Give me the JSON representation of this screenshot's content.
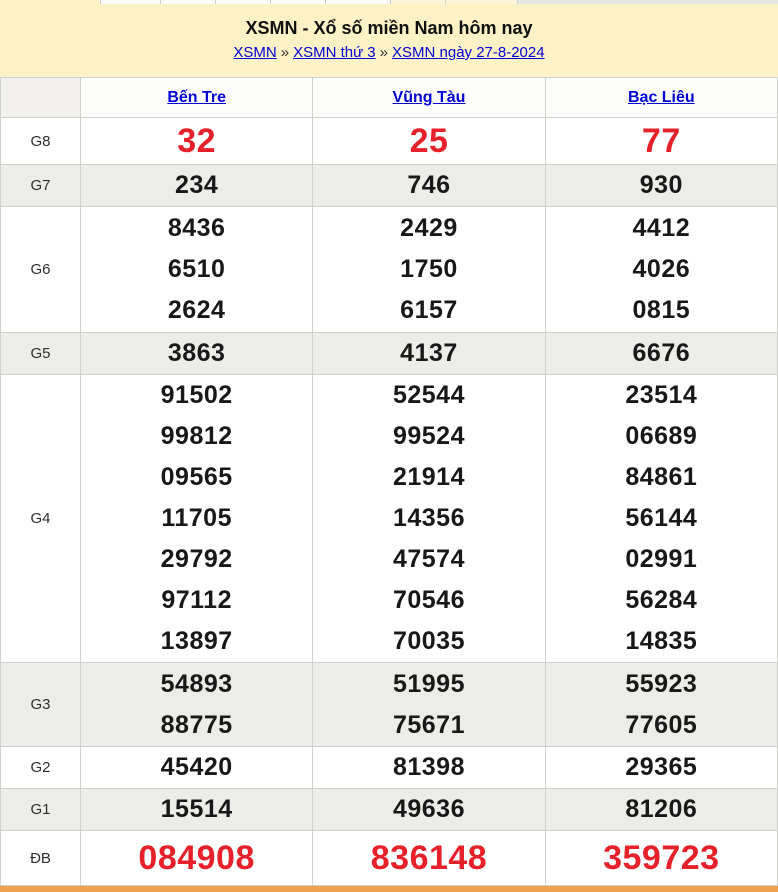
{
  "header": {
    "title": "XSMN - Xổ số miền Nam hôm nay",
    "breadcrumb": {
      "separator": "»",
      "items": [
        {
          "label": "XSMN"
        },
        {
          "label": "XSMN thứ 3"
        },
        {
          "label": "XSMN ngày 27-8-2024"
        }
      ]
    }
  },
  "table": {
    "columns": [
      "Bến Tre",
      "Vũng Tàu",
      "Bạc Liêu"
    ],
    "rows": [
      {
        "prize": "G8",
        "key": "g8",
        "highlight": true,
        "values": [
          [
            "32"
          ],
          [
            "25"
          ],
          [
            "77"
          ]
        ]
      },
      {
        "prize": "G7",
        "key": "g7",
        "highlight": false,
        "values": [
          [
            "234"
          ],
          [
            "746"
          ],
          [
            "930"
          ]
        ]
      },
      {
        "prize": "G6",
        "key": "g6",
        "highlight": false,
        "values": [
          [
            "8436",
            "6510",
            "2624"
          ],
          [
            "2429",
            "1750",
            "6157"
          ],
          [
            "4412",
            "4026",
            "0815"
          ]
        ]
      },
      {
        "prize": "G5",
        "key": "g5",
        "highlight": false,
        "values": [
          [
            "3863"
          ],
          [
            "4137"
          ],
          [
            "6676"
          ]
        ]
      },
      {
        "prize": "G4",
        "key": "g4",
        "highlight": false,
        "values": [
          [
            "91502",
            "99812",
            "09565",
            "11705",
            "29792",
            "97112",
            "13897"
          ],
          [
            "52544",
            "99524",
            "21914",
            "14356",
            "47574",
            "70546",
            "70035"
          ],
          [
            "23514",
            "06689",
            "84861",
            "56144",
            "02991",
            "56284",
            "14835"
          ]
        ]
      },
      {
        "prize": "G3",
        "key": "g3",
        "highlight": false,
        "values": [
          [
            "54893",
            "88775"
          ],
          [
            "51995",
            "75671"
          ],
          [
            "55923",
            "77605"
          ]
        ]
      },
      {
        "prize": "G2",
        "key": "g2",
        "highlight": false,
        "values": [
          [
            "45420"
          ],
          [
            "81398"
          ],
          [
            "29365"
          ]
        ]
      },
      {
        "prize": "G1",
        "key": "g1",
        "highlight": false,
        "values": [
          [
            "15514"
          ],
          [
            "49636"
          ],
          [
            "81206"
          ]
        ]
      },
      {
        "prize": "ĐB",
        "key": "db",
        "highlight": true,
        "values": [
          [
            "084908"
          ],
          [
            "836148"
          ],
          [
            "359723"
          ]
        ]
      }
    ]
  },
  "colors": {
    "accent_red": "#E62129",
    "link_blue": "#0000D4",
    "header_yellow": "#FDF2C5",
    "row_alt_gray": "#ECECE9",
    "table_border": "#D0D0CD",
    "bottom_bar_orange": "#EDA14F"
  }
}
